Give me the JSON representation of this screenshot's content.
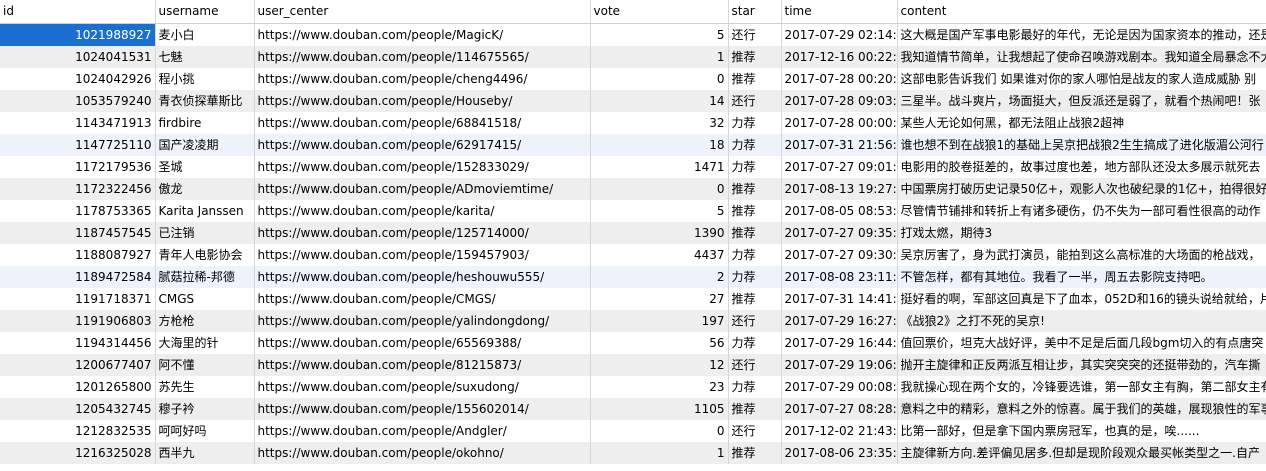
{
  "columns": {
    "id": "id",
    "username": "username",
    "user_center": "user_center",
    "vote": "vote",
    "star": "star",
    "time": "time",
    "content": "content"
  },
  "selection_color": "#1a6fd0",
  "rows": [
    {
      "id": "1021988927",
      "username": "麦小白",
      "user_center": "https://www.douban.com/people/MagicK/",
      "vote": "5",
      "star": "还行",
      "time": "2017-07-29 02:14:3",
      "content": "这大概是国产军事电影最好的年代，无论是因为国家资本的推动，还是"
    },
    {
      "id": "1024041531",
      "username": "七魅",
      "user_center": "https://www.douban.com/people/114675565/",
      "vote": "1",
      "star": "推荐",
      "time": "2017-12-16 00:22:1",
      "content": "我知道情节简单，让我想起了使命召唤游戏剧本。我知道全局暴念不大"
    },
    {
      "id": "1024042926",
      "username": "程小挑",
      "user_center": "https://www.douban.com/people/cheng4496/",
      "vote": "0",
      "star": "推荐",
      "time": "2017-07-28 00:20:3",
      "content": "这部电影告诉我们 如果谁对你的家人哪怕是战友的家人造成威胁 别"
    },
    {
      "id": "1053579240",
      "username": "青衣侦探華斯比",
      "user_center": "https://www.douban.com/people/Houseby/",
      "vote": "14",
      "star": "还行",
      "time": "2017-07-28 09:03:1",
      "content": "三星半。战斗爽片，场面挺大，但反派还是弱了，就看个热闹吧！张"
    },
    {
      "id": "1143471913",
      "username": "firdbire",
      "user_center": "https://www.douban.com/people/68841518/",
      "vote": "32",
      "star": "力荐",
      "time": "2017-07-28 00:00:0",
      "content": "某些人无论如何黑，都无法阻止战狼2超神"
    },
    {
      "id": "1147725110",
      "username": "国产凌凌期",
      "user_center": "https://www.douban.com/people/62917415/",
      "vote": "18",
      "star": "力荐",
      "time": "2017-07-31 21:56:2",
      "content": "谁也想不到在战狼1的基础上吴京把战狼2生生搞成了进化版湄公河行"
    },
    {
      "id": "1172179536",
      "username": "圣城",
      "user_center": "https://www.douban.com/people/152833029/",
      "vote": "1471",
      "star": "力荐",
      "time": "2017-07-27 09:01:5",
      "content": "电影用的胶卷挺差的，故事过度也差，地方部队还没太多展示就死去"
    },
    {
      "id": "1172322456",
      "username": "傲龙",
      "user_center": "https://www.douban.com/people/ADmoviemtime/",
      "vote": "0",
      "star": "推荐",
      "time": "2017-08-13 19:27:5",
      "content": "中国票房打破历史记录50亿+，观影人次也破纪录的1亿+，拍得很好"
    },
    {
      "id": "1178753365",
      "username": "Karita Janssen",
      "user_center": "https://www.douban.com/people/karita/",
      "vote": "5",
      "star": "推荐",
      "time": "2017-08-05 08:53:5",
      "content": "尽管情节铺排和转折上有诸多硬伤，仍不失为一部可看性很高的动作"
    },
    {
      "id": "1187457545",
      "username": "已注销",
      "user_center": "https://www.douban.com/people/125714000/",
      "vote": "1390",
      "star": "推荐",
      "time": "2017-07-27 09:35:2",
      "content": "打戏太燃，期待3"
    },
    {
      "id": "1188087927",
      "username": "青年人电影协会",
      "user_center": "https://www.douban.com/people/159457903/",
      "vote": "4437",
      "star": "力荐",
      "time": "2017-07-27 09:30:4",
      "content": "吴京厉害了，身为武打演员，能拍到这么高标准的大场面的枪战戏，"
    },
    {
      "id": "1189472584",
      "username": "腻菇拉稀-邦德",
      "user_center": "https://www.douban.com/people/heshouwu555/",
      "vote": "2",
      "star": "力荐",
      "time": "2017-08-08 23:11:1",
      "content": "不管怎样，都有其地位。我看了一半，周五去影院支持吧。"
    },
    {
      "id": "1191718371",
      "username": "CMGS",
      "user_center": "https://www.douban.com/people/CMGS/",
      "vote": "27",
      "star": "推荐",
      "time": "2017-07-31 14:41:5",
      "content": "挺好看的啊，军部这回真是下了血本，052D和16的镜头说给就给，片"
    },
    {
      "id": "1191906803",
      "username": "方枪枪",
      "user_center": "https://www.douban.com/people/yalindongdong/",
      "vote": "197",
      "star": "还行",
      "time": "2017-07-29 16:27:0",
      "content": "《战狼2》之打不死的吴京!"
    },
    {
      "id": "1194314456",
      "username": "大海里的针",
      "user_center": "https://www.douban.com/people/65569388/",
      "vote": "56",
      "star": "力荐",
      "time": "2017-07-29 16:44:3",
      "content": "值回票价，坦克大战好评，美中不足是后面几段bgm切入的有点唐突"
    },
    {
      "id": "1200677407",
      "username": "阿不懂",
      "user_center": "https://www.douban.com/people/81215873/",
      "vote": "12",
      "star": "还行",
      "time": "2017-07-29 19:06:5",
      "content": "抛开主旋律和正反两派互相让步，其实突突突的还挺带劲的，汽车撕"
    },
    {
      "id": "1201265800",
      "username": "苏先生",
      "user_center": "https://www.douban.com/people/suxudong/",
      "vote": "23",
      "star": "力荐",
      "time": "2017-07-29 00:08:1",
      "content": "我就操心现在两个女的，冷锋要选谁，第一部女主有胸，第二部女主有"
    },
    {
      "id": "1205432745",
      "username": "穆子衿",
      "user_center": "https://www.douban.com/people/155602014/",
      "vote": "1105",
      "star": "推荐",
      "time": "2017-07-27 08:28:2",
      "content": "意料之中的精彩，意料之外的惊喜。属于我们的英雄，展现狼性的军事"
    },
    {
      "id": "1212832535",
      "username": "呵呵好吗",
      "user_center": "https://www.douban.com/people/Andgler/",
      "vote": "0",
      "star": "还行",
      "time": "2017-12-02 21:43:0",
      "content": "比第一部好，但是拿下国内票房冠军，也真的是，唉......"
    },
    {
      "id": "1216325028",
      "username": "西半九",
      "user_center": "https://www.douban.com/people/okohno/",
      "vote": "1",
      "star": "推荐",
      "time": "2017-08-06 23:35:5",
      "content": "主旋律新方向.差评偏见居多.但却是现阶段观众最买帐类型之一.自产"
    }
  ]
}
